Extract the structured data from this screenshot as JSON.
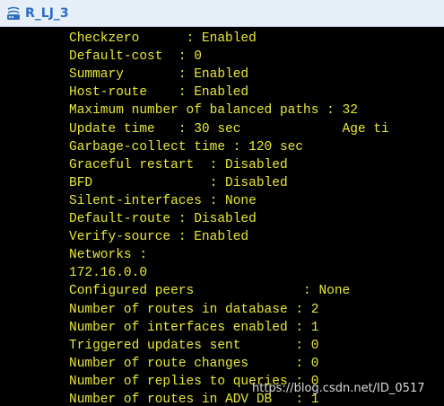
{
  "window": {
    "title": "R_LJ_3",
    "title_icon": "network-device-icon",
    "title_color": "#2a6fc4",
    "titlebar_bg": "#e6eef8"
  },
  "terminal": {
    "bg": "#000000",
    "fg": "#e8e836",
    "lines": [
      "Checkzero      : Enabled",
      "Default-cost  : 0",
      "Summary       : Enabled",
      "Host-route    : Enabled",
      "Maximum number of balanced paths : 32",
      "Update time   : 30 sec             Age ti",
      "Garbage-collect time : 120 sec",
      "Graceful restart  : Disabled",
      "BFD               : Disabled",
      "Silent-interfaces : None",
      "Default-route : Disabled",
      "Verify-source : Enabled",
      "Networks :",
      "172.16.0.0",
      "Configured peers              : None",
      "Number of routes in database : 2",
      "Number of interfaces enabled : 1",
      "Triggered updates sent       : 0",
      "Number of route changes      : 0",
      "Number of replies to queries : 0",
      "Number of routes in ADV DB   : 1"
    ]
  },
  "watermark": "https://blog.csdn.net/ID_0517"
}
